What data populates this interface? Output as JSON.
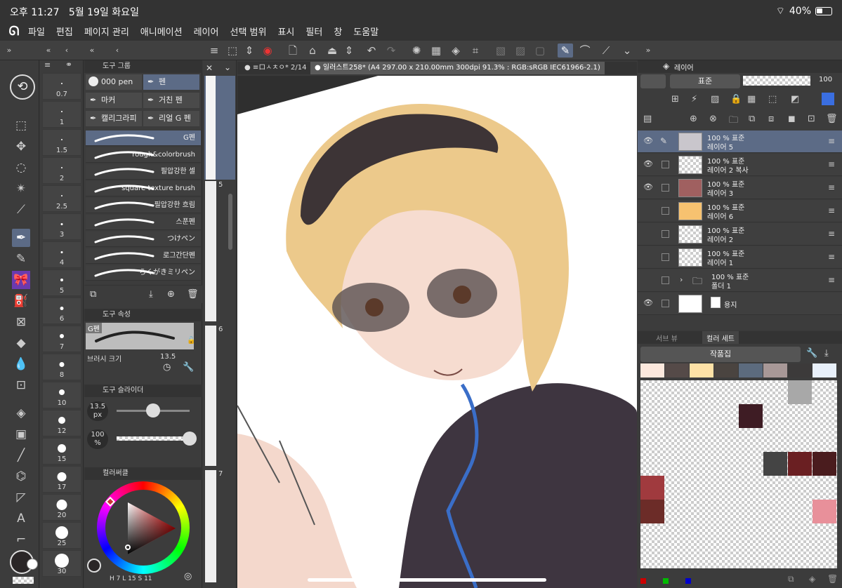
{
  "status": {
    "time": "오후 11:27",
    "date": "5월 19일 화요일",
    "battery": "40%"
  },
  "menu": [
    "파일",
    "편집",
    "페이지 관리",
    "애니메이션",
    "레이어",
    "선택 범위",
    "표시",
    "필터",
    "창",
    "도움말"
  ],
  "sizes": [
    "0.7",
    "1",
    "1.5",
    "2",
    "2.5",
    "3",
    "4",
    "5",
    "6",
    "7",
    "8",
    "10",
    "12",
    "15",
    "17",
    "20",
    "25",
    "30"
  ],
  "toolpanel": {
    "group_title": "도구 그룹",
    "groups": [
      "000 pen",
      "펜",
      "마커",
      "거친 펜",
      "캘리그라피",
      "리얼 G 펜"
    ],
    "brushes": [
      "G펜",
      "rough&colorbrush",
      "필압강한 셀",
      "square texture brush",
      "필압강한 흐림",
      "스푼펜",
      "つけペン",
      "로그간단펜",
      "らくがきミリペン"
    ],
    "prop_title": "도구 속성",
    "prop_brush": "G펜",
    "brush_size_label": "브러시 크기",
    "brush_size_value": "13.5",
    "slider_title": "도구 슬라이더",
    "slider_size": "13.5",
    "slider_size_unit": "px",
    "slider_opacity": "100",
    "slider_opacity_unit": "%",
    "color_title": "컬러써클",
    "color_values": [
      "H",
      "7",
      "L",
      "15",
      "S",
      "11"
    ]
  },
  "pages": [
    "5",
    "6",
    "7"
  ],
  "doc": {
    "tab1": "● ≡ロㅅㅊㅇ* 2/14",
    "tab2": "● 일러스트258* (A4 297.00 x 210.00mm 300dpi 91.3% : RGB:sRGB IEC61966-2.1)"
  },
  "layers": {
    "tab_label": "레이어",
    "blend": "표준",
    "opacity": "100",
    "rows": [
      {
        "l1": "100 % 표준",
        "l2": "레이어 5",
        "eye": true,
        "pen": true
      },
      {
        "l1": "100 % 표준",
        "l2": "레이어 2 복사",
        "eye": true
      },
      {
        "l1": "100 % 표준",
        "l2": "레이어 3",
        "eye": true
      },
      {
        "l1": "100 % 표준",
        "l2": "레이어 6",
        "eye": false
      },
      {
        "l1": "100 % 표준",
        "l2": "레이어 2",
        "eye": false
      },
      {
        "l1": "100 % 표준",
        "l2": "레이어 1",
        "eye": false
      },
      {
        "l1": "100 % 표준",
        "l2": "폴더 1",
        "eye": false
      },
      {
        "l1": "",
        "l2": "용지",
        "eye": true
      }
    ]
  },
  "colorset": {
    "tab1": "서브 뷰",
    "tab2": "컬러 세트",
    "set_name": "작품집",
    "top_row": [
      "#fce8dd",
      "#554a48",
      "#fde1a6",
      "#4a4440",
      "#5c6b7e",
      "#a89897",
      "#3c3a3a",
      "#e8f0fa"
    ],
    "cells": [
      {
        "r": 0,
        "c": 6,
        "color": "#a8a8a8"
      },
      {
        "r": 1,
        "c": 4,
        "color": "#3e1c24"
      },
      {
        "r": 3,
        "c": 5,
        "color": "#444444"
      },
      {
        "r": 3,
        "c": 6,
        "color": "#6a1f22"
      },
      {
        "r": 3,
        "c": 7,
        "color": "#4a1c1e"
      },
      {
        "r": 4,
        "c": 0,
        "color": "#a03a3e"
      },
      {
        "r": 5,
        "c": 0,
        "color": "#6c2c28"
      },
      {
        "r": 5,
        "c": 7,
        "color": "#e8909a"
      }
    ]
  }
}
